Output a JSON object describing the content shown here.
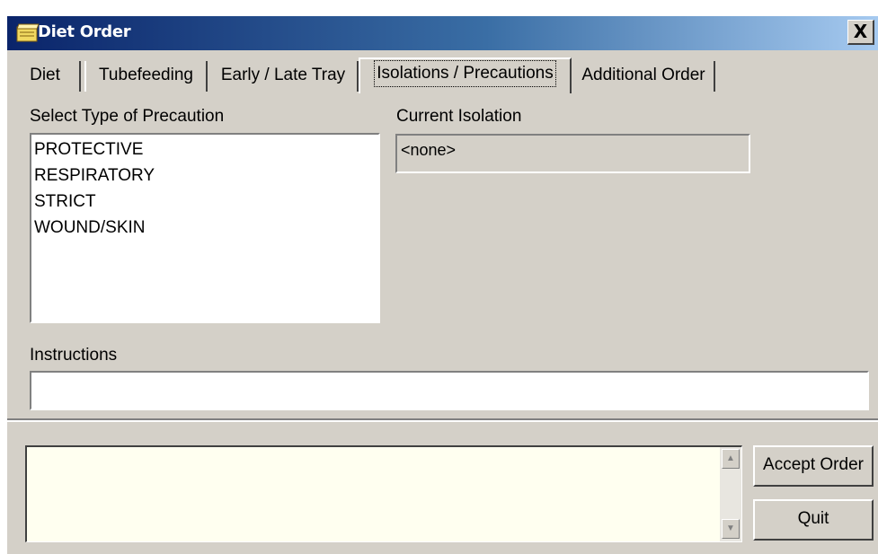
{
  "window": {
    "title": "Diet Order",
    "close_label": "X"
  },
  "tabs": [
    {
      "label": "Diet",
      "active": false
    },
    {
      "label": "Tubefeeding",
      "active": false
    },
    {
      "label": "Early / Late Tray",
      "active": false
    },
    {
      "label": "Isolations / Precautions",
      "active": true
    },
    {
      "label": "Additional Order",
      "active": false
    }
  ],
  "precaution": {
    "label": "Select Type of Precaution",
    "items": [
      "PROTECTIVE",
      "RESPIRATORY",
      "STRICT",
      "WOUND/SKIN"
    ]
  },
  "current_isolation": {
    "label": "Current Isolation",
    "value": "<none>"
  },
  "instructions": {
    "label": "Instructions",
    "value": ""
  },
  "buttons": {
    "accept": "Accept Order",
    "quit": "Quit"
  },
  "colors": {
    "titlebar_start": "#0a246a",
    "titlebar_end": "#a6caf0",
    "window_bg": "#d4d0c8",
    "memo_bg": "#fffff0"
  }
}
